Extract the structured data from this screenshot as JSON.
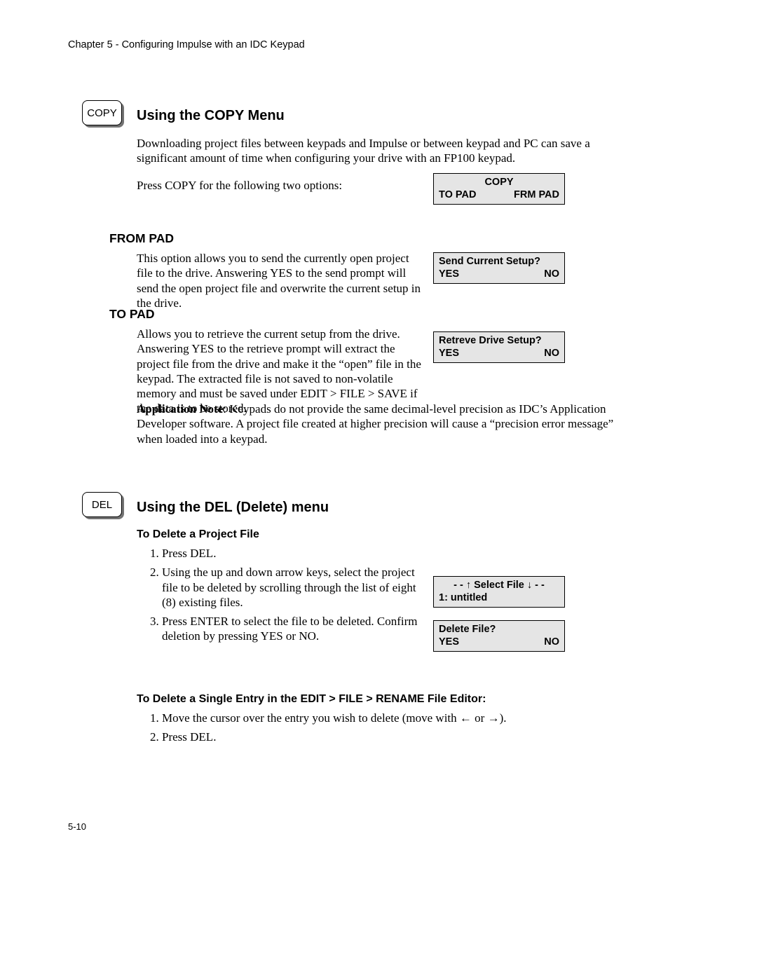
{
  "running_head": "Chapter 5 - Configuring Impulse with an IDC Keypad",
  "page_number": "5-10",
  "copy": {
    "key_label": "COPY",
    "heading": "Using the COPY Menu",
    "intro": "Downloading project files between keypads and Impulse or between keypad and PC can save a significant amount of time when configuring your drive with an FP100 keypad.",
    "press_line": "Press COPY for the following two options:",
    "lcd_main": {
      "title": "COPY",
      "left": "TO PAD",
      "right": "FRM PAD"
    },
    "from_pad": {
      "heading": "FROM PAD",
      "body": "This option allows you to send the currently open project file to the drive. Answering YES to the send prompt will send the open project file and overwrite the current setup in the drive.",
      "lcd": {
        "title": "Send Current Setup?",
        "yes": "YES",
        "no": "NO"
      }
    },
    "to_pad": {
      "heading": "TO PAD",
      "body": "Allows you to retrieve the current setup from the drive. Answering YES to the retrieve prompt will extract the project file from the drive and make it the “open” file in the keypad. The extracted file is not saved to non-volatile memory and must be saved under EDIT > FILE > SAVE if the data is to be stored.",
      "lcd": {
        "title": "Retreve Drive Setup?",
        "yes": "YES",
        "no": "NO"
      }
    },
    "app_note_label": "Application Note",
    "app_note_body": ": Keypads do not provide the same decimal-level precision as IDC’s Application Developer software. A project file created at higher precision will cause a “precision error message” when loaded into a keypad."
  },
  "del": {
    "key_label": "DEL",
    "heading": "Using the DEL (Delete) menu",
    "section1": {
      "heading": "To Delete a Project File",
      "steps": {
        "s1": "Press DEL.",
        "s2": "Using the up and down arrow keys, select the project file to be deleted by scrolling through the list of eight (8) existing files.",
        "s3": "Press ENTER to select the file to be deleted. Confirm deletion by pressing YES or NO."
      },
      "lcd_select": {
        "line1_prefix": "- -  ",
        "line1_mid": "  Select  File  ",
        "line1_suffix": "  - -",
        "line2": "1: untitled"
      },
      "lcd_confirm": {
        "title": "Delete File?",
        "yes": "YES",
        "no": "NO"
      }
    },
    "section2": {
      "heading": "To Delete a Single Entry in the EDIT > FILE > RENAME File Editor:",
      "steps": {
        "s1_pre": "Move the cursor over the entry you wish to delete (move with ",
        "s1_mid": "  or  ",
        "s1_post": ").",
        "s2": "Press DEL."
      }
    }
  }
}
